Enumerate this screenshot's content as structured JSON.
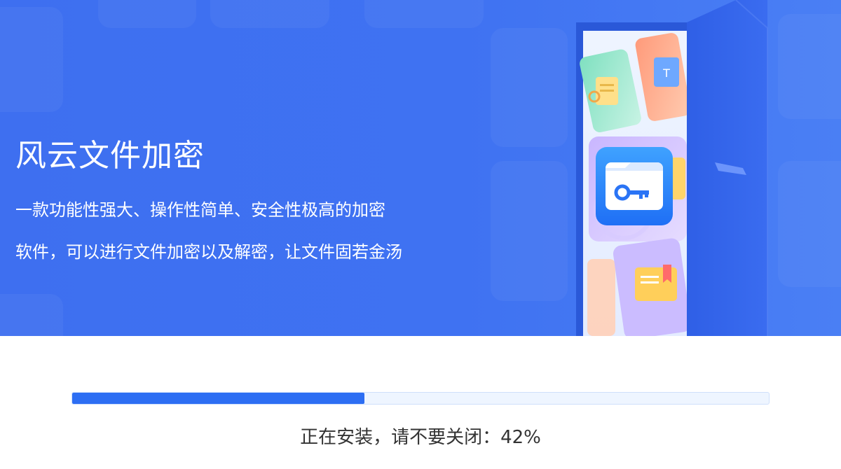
{
  "banner": {
    "title": "风云文件加密",
    "description_line1": "一款功能性强大、操作性简单、安全性极高的加密",
    "description_line2": "软件，可以进行文件加密以及解密，让文件固若金汤",
    "illustration_icons": [
      "document-icon",
      "text-file-icon",
      "encrypted-folder-key-icon",
      "folder-bookmark-icon"
    ]
  },
  "install": {
    "progress": 0.42,
    "status_text": "正在安装，请不要关闭：42%"
  },
  "colors": {
    "banner_blue": "#3f72f2",
    "progress_fill": "#2d6ef3",
    "progress_track": "#eef5ff",
    "status_text": "#333333"
  }
}
